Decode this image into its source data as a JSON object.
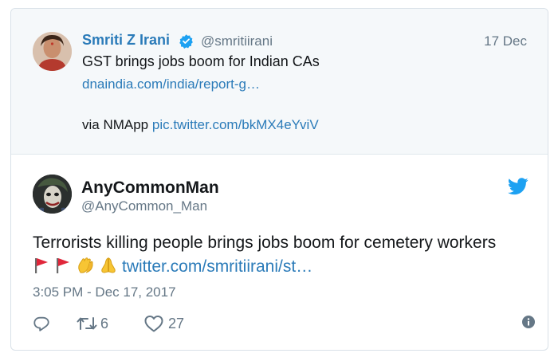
{
  "quoted": {
    "name": "Smriti Z Irani",
    "handle": "@smritiirani",
    "date": "17 Dec",
    "text": "GST brings jobs boom for Indian CAs",
    "link": "dnaindia.com/india/report-g…",
    "via_prefix": "via NMApp",
    "via_link": "pic.twitter.com/bkMX4eYviV"
  },
  "tweet": {
    "name": "AnyCommonMan",
    "handle": "@AnyCommon_Man",
    "text": "Terrorists killing people brings jobs boom for cemetery workers",
    "link": "twitter.com/smritiirani/st…",
    "timestamp": "3:05 PM - Dec 17, 2017",
    "retweets": "6",
    "likes": "27"
  },
  "icons": [
    "verified-badge-icon",
    "twitter-bird-icon",
    "red-flag-icon",
    "clapping-hands-icon",
    "folded-hands-icon",
    "reply-icon",
    "retweet-icon",
    "heart-icon",
    "info-icon"
  ],
  "colors": {
    "link": "#2b7bb9",
    "muted": "#657786",
    "text": "#14171a",
    "quoted_bg": "#f5f8fa",
    "twitter_blue": "#1da1f2"
  }
}
